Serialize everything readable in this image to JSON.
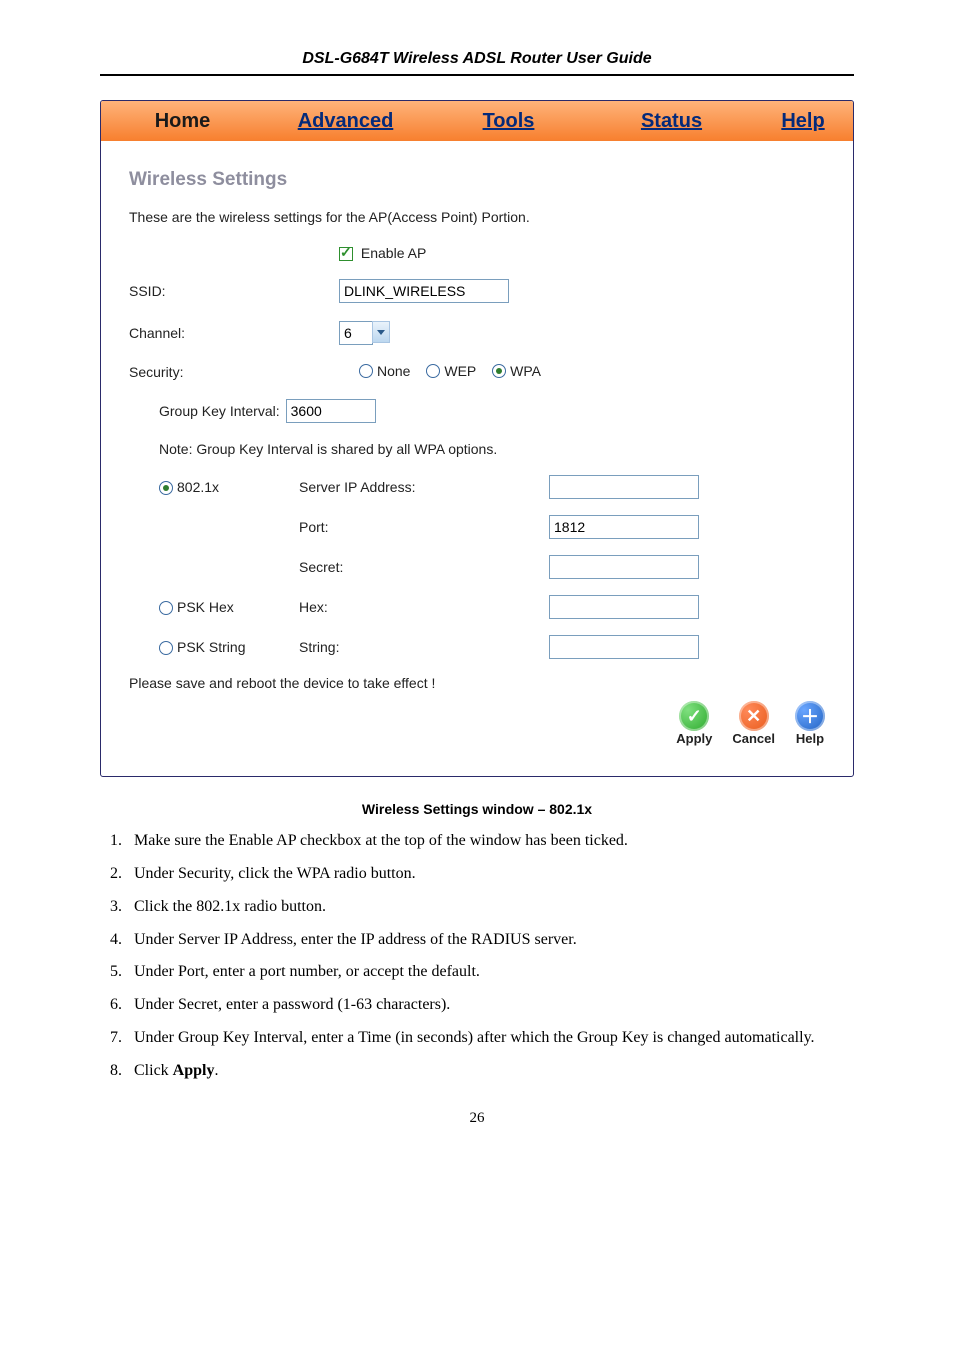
{
  "header": {
    "title": "DSL-G684T Wireless ADSL Router User Guide"
  },
  "tabs": {
    "home": "Home",
    "advanced": "Advanced",
    "tools": "Tools",
    "status": "Status",
    "help": "Help"
  },
  "wireless": {
    "section_title": "Wireless Settings",
    "desc": "These are the wireless settings for the AP(Access Point) Portion.",
    "enable_ap_label": "Enable AP",
    "ssid_label": "SSID:",
    "ssid_value": "DLINK_WIRELESS",
    "channel_label": "Channel:",
    "channel_value": "6",
    "security_label": "Security:",
    "sec_none": "None",
    "sec_wep": "WEP",
    "sec_wpa": "WPA",
    "gki_label": "Group Key Interval:",
    "gki_value": "3600",
    "gki_note": "Note: Group Key Interval is shared by all WPA options.",
    "opt_8021x": "802.1x",
    "srv_ip_label": "Server IP Address:",
    "srv_ip_value": "",
    "port_label": "Port:",
    "port_value": "1812",
    "secret_label": "Secret:",
    "secret_value": "",
    "opt_pskhex": "PSK Hex",
    "hex_label": "Hex:",
    "hex_value": "",
    "opt_pskstr": "PSK String",
    "str_label": "String:",
    "str_value": "",
    "save_note": "Please save and reboot the device to take effect !",
    "actions": {
      "apply": "Apply",
      "cancel": "Cancel",
      "help": "Help"
    }
  },
  "caption": "Wireless Settings window – 802.1x",
  "steps": [
    "Make sure the Enable AP checkbox at the top of the window has been ticked.",
    "Under Security, click the WPA radio button.",
    "Click the 802.1x radio button.",
    "Under Server IP Address, enter the IP address of the RADIUS server.",
    "Under Port, enter a port number, or accept the default.",
    "Under Secret, enter a password (1-63 characters).",
    "Under Group Key Interval, enter a Time (in seconds) after which the Group Key is changed automatically."
  ],
  "step8_prefix": "Click ",
  "step8_bold": "Apply",
  "step8_suffix": ".",
  "page_number": "26"
}
